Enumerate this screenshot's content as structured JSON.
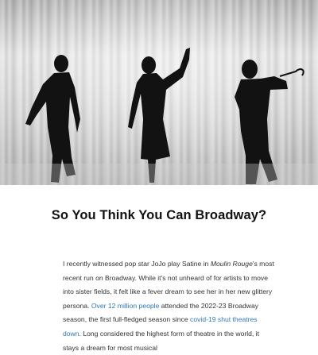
{
  "article": {
    "title": "So You Think You Can Broadway?",
    "paragraph": {
      "t1": "I recently witnessed pop star JoJo play Satine in ",
      "em1": "Moulin Rouge",
      "t2": "'s most recent run on Broadway. While it's not unheard of for artists to move into sister fields, it felt like a fever dream to see her in her new glittery persona. ",
      "link1": "Over 12 million people",
      "t3": " attended the 2022-23 Broadway season, the first full-fledged season since ",
      "link2": "covid-19 shut theatres down",
      "t4": ". Long considered the highest form of theatre in the world, it stays a dream for most musical"
    }
  },
  "hero_image": {
    "subject": "three dancer silhouettes in front of a pleated white curtain"
  }
}
